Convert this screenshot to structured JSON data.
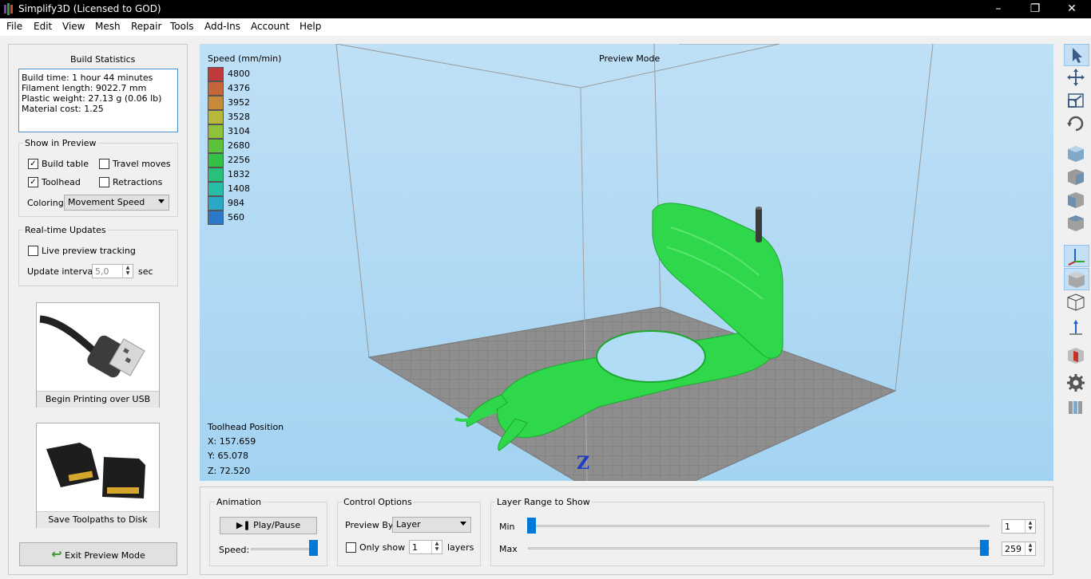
{
  "window": {
    "title": "Simplify3D (Licensed to GOD)"
  },
  "menu": [
    "File",
    "Edit",
    "View",
    "Mesh",
    "Repair",
    "Tools",
    "Add-Ins",
    "Account",
    "Help"
  ],
  "build_stats": {
    "title": "Build Statistics",
    "lines": [
      "Build time: 1 hour 44 minutes",
      "Filament length: 9022.7 mm",
      "Plastic weight: 27.13 g (0.06 lb)",
      "Material cost: 1.25"
    ]
  },
  "show_in_preview": {
    "title": "Show in Preview",
    "build_table": "Build table",
    "travel_moves": "Travel moves",
    "toolhead": "Toolhead",
    "retractions": "Retractions",
    "coloring_label": "Coloring",
    "coloring_value": "Movement Speed",
    "build_table_checked": true,
    "travel_moves_checked": false,
    "toolhead_checked": true,
    "retractions_checked": false
  },
  "realtime": {
    "title": "Real-time Updates",
    "live_tracking": "Live preview tracking",
    "live_tracking_checked": false,
    "interval_label": "Update interval",
    "interval_value": "5,0",
    "interval_unit": "sec"
  },
  "usb_tile": {
    "label": "Begin Printing over USB"
  },
  "sd_tile": {
    "label": "Save Toolpaths to Disk"
  },
  "exit_button": "Exit Preview Mode",
  "viewport": {
    "mode": "Preview Mode",
    "legend_title": "Speed (mm/min)",
    "legend": [
      {
        "value": "4800",
        "color": "#c0393b"
      },
      {
        "value": "4376",
        "color": "#c6643a"
      },
      {
        "value": "3952",
        "color": "#c68a3a"
      },
      {
        "value": "3528",
        "color": "#b6b83a"
      },
      {
        "value": "3104",
        "color": "#8fc23a"
      },
      {
        "value": "2680",
        "color": "#5cc23a"
      },
      {
        "value": "2256",
        "color": "#33c047"
      },
      {
        "value": "1832",
        "color": "#28c07a"
      },
      {
        "value": "1408",
        "color": "#28bda5"
      },
      {
        "value": "984",
        "color": "#2aa8c6"
      },
      {
        "value": "560",
        "color": "#2a78c6"
      }
    ],
    "toolhead": {
      "title": "Toolhead Position",
      "x": "X: 157.659",
      "y": "Y: 65.078",
      "z": "Z: 72.520"
    },
    "axis_z": "Z"
  },
  "animation": {
    "title": "Animation",
    "play_label": "Play/Pause",
    "speed_label": "Speed:"
  },
  "control": {
    "title": "Control Options",
    "preview_by_label": "Preview By",
    "preview_by_value": "Layer",
    "only_show_label": "Only show",
    "only_show_value": "1",
    "layers_label": "layers",
    "only_show_checked": false
  },
  "layer_range": {
    "title": "Layer Range to Show",
    "min_label": "Min",
    "min_value": "1",
    "max_label": "Max",
    "max_value": "259"
  },
  "colors": {
    "accent": "#0078d7",
    "plate": "#8e8e8e",
    "print_green": "#2fd84a"
  }
}
